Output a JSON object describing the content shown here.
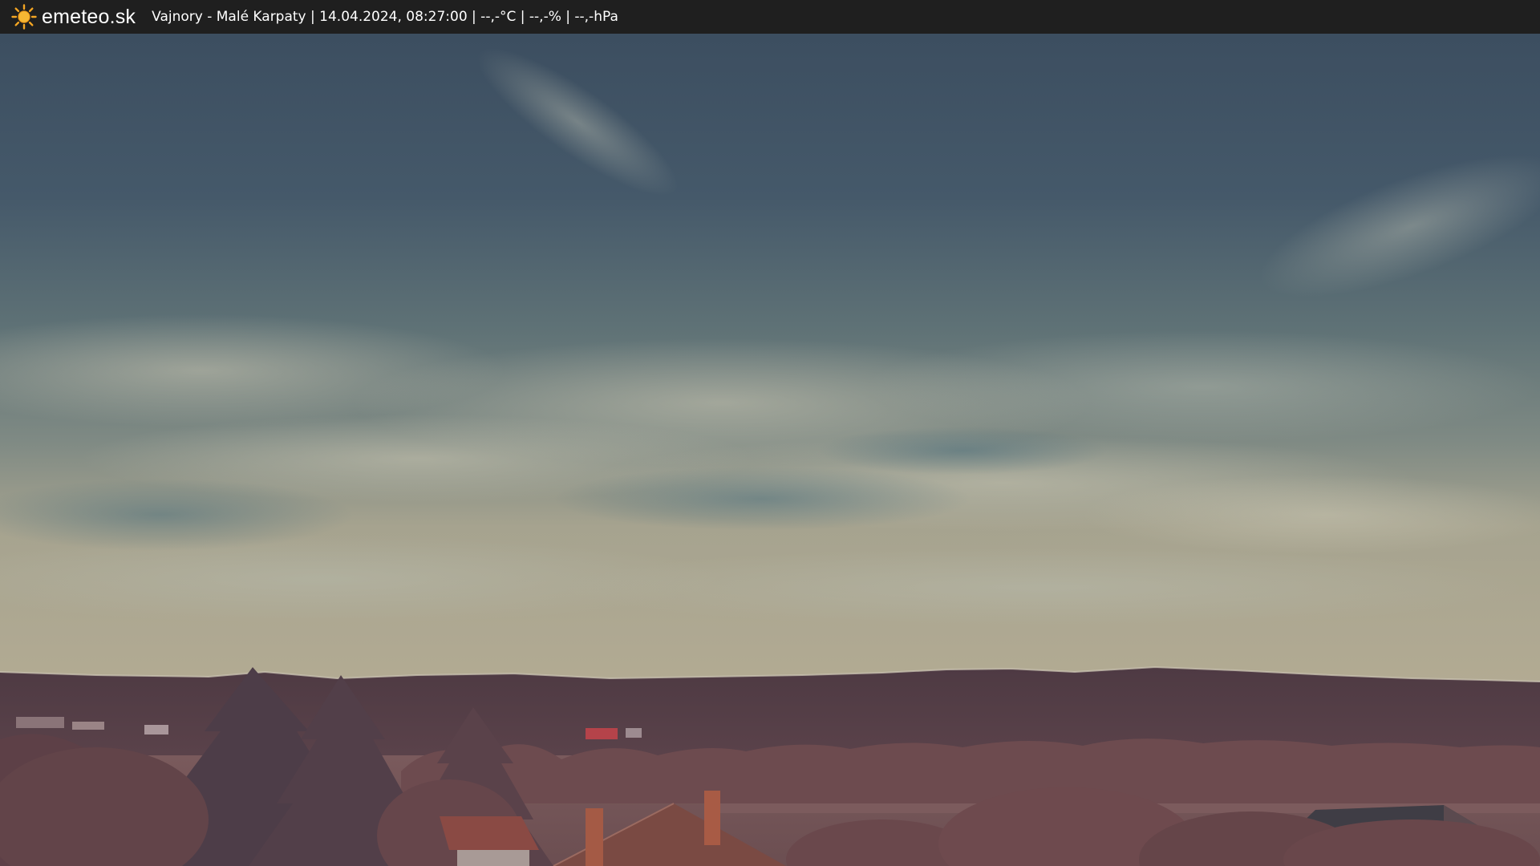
{
  "header": {
    "brand": "emeteo.sk",
    "status": "Vajnory - Malé Karpaty | 14.04.2024, 08:27:00 | --,-°C | --,-% | --,-hPa"
  },
  "icons": {
    "logo": "sun-icon"
  },
  "colors": {
    "bar": "#1f1f1f",
    "sun": "#f5a623",
    "sky_top": "#3f5264",
    "sky_horizon": "#a9a48e",
    "hills": "#4c383f",
    "foliage": "#6e4b4d"
  }
}
